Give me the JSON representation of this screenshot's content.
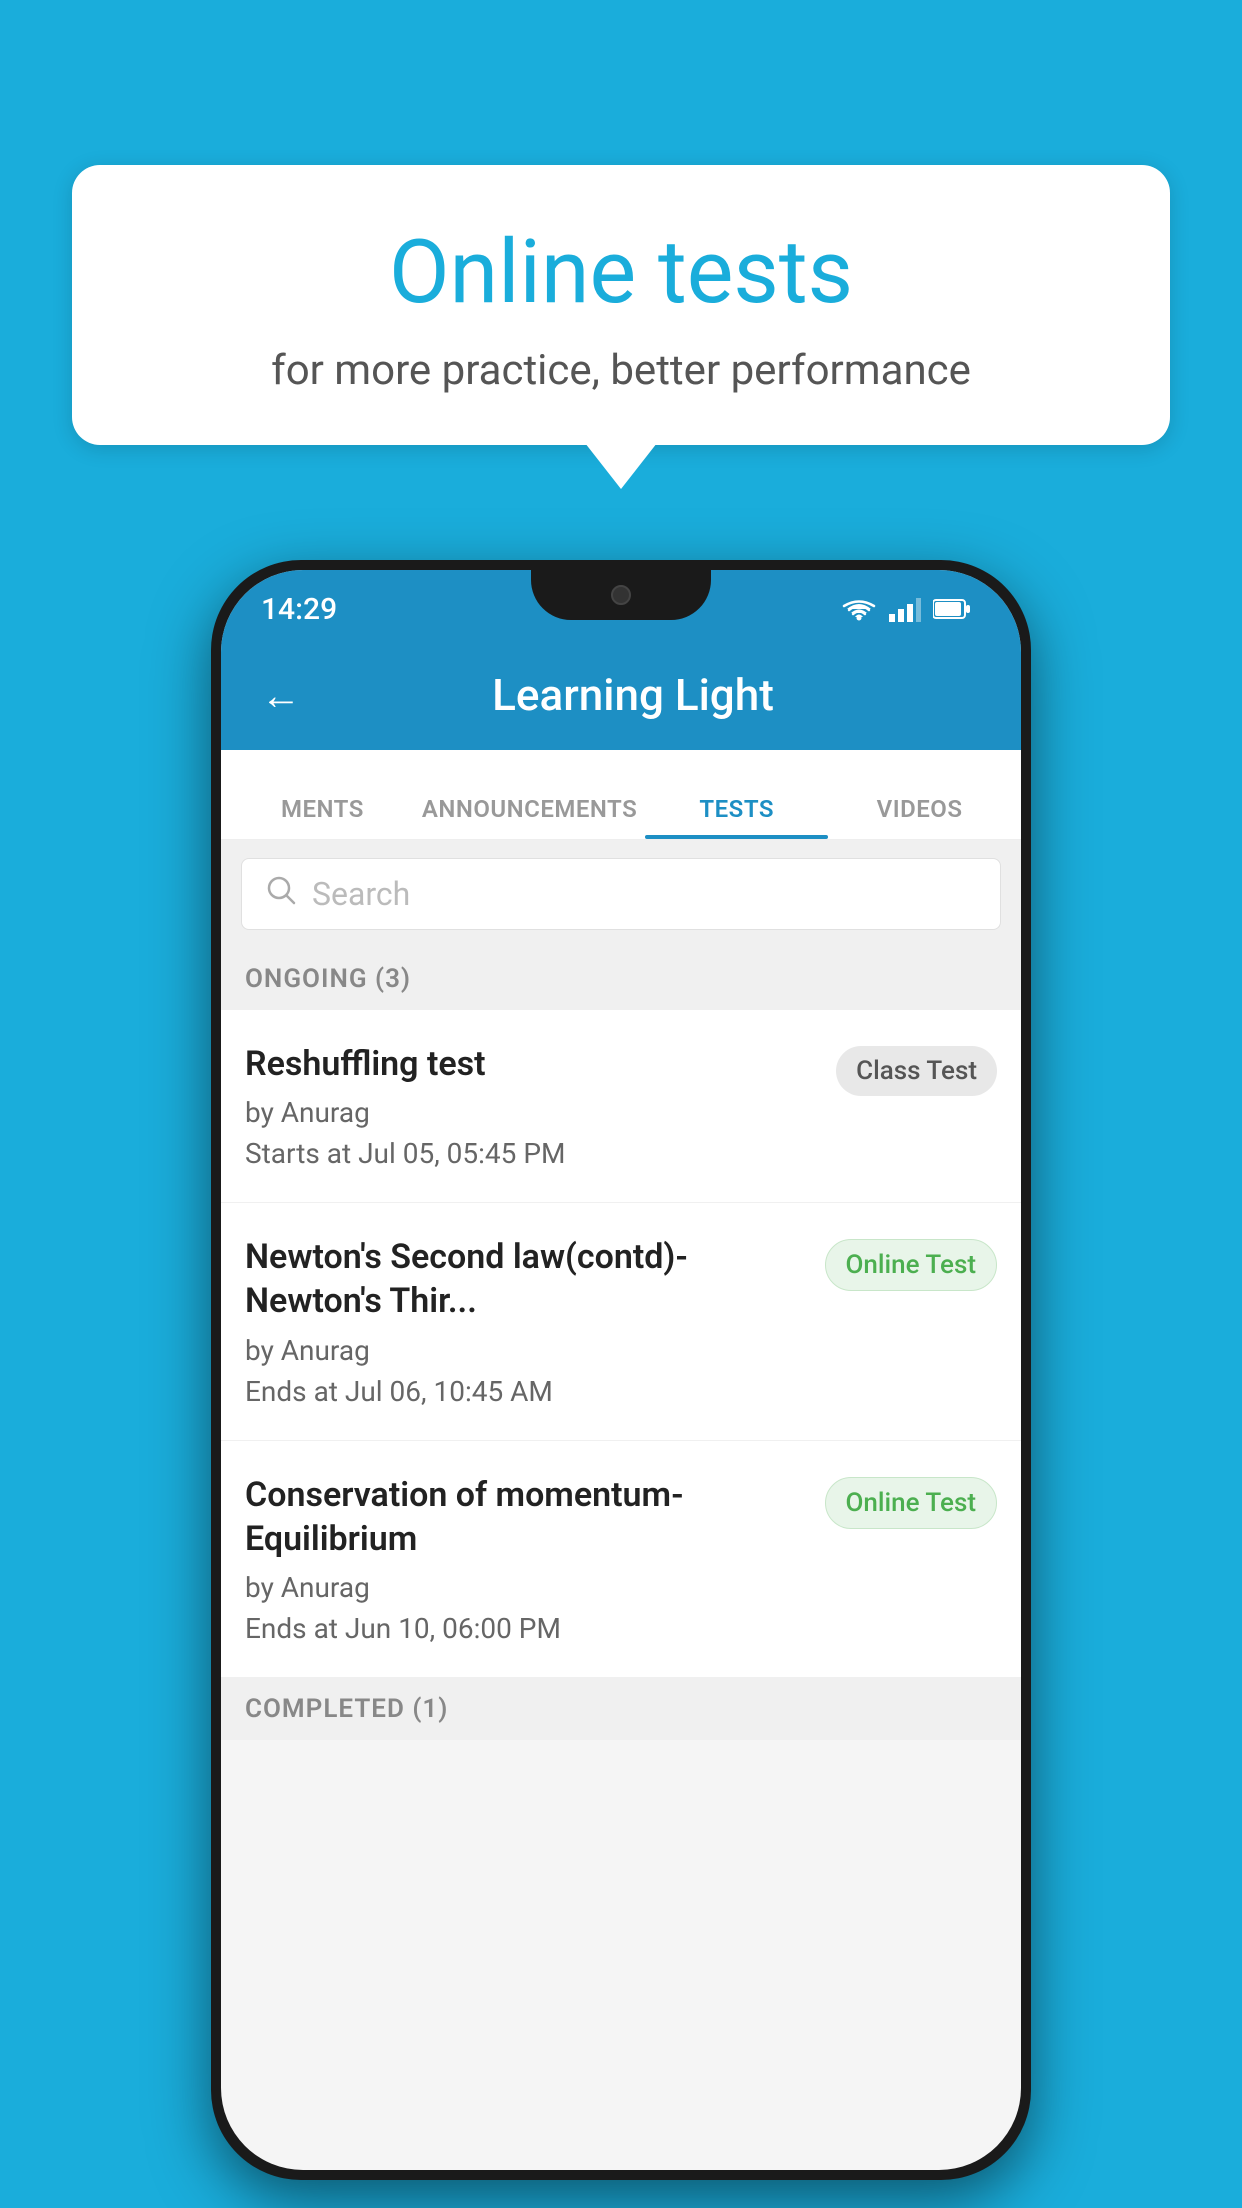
{
  "background": {
    "color": "#1AADDB"
  },
  "bubble": {
    "title": "Online tests",
    "subtitle": "for more practice, better performance"
  },
  "phone": {
    "status": {
      "time": "14:29"
    },
    "header": {
      "title": "Learning Light",
      "back_label": "←"
    },
    "tabs": [
      {
        "label": "MENTS",
        "active": false
      },
      {
        "label": "ANNOUNCEMENTS",
        "active": false
      },
      {
        "label": "TESTS",
        "active": true
      },
      {
        "label": "VIDEOS",
        "active": false
      }
    ],
    "search": {
      "placeholder": "Search"
    },
    "ongoing_section": {
      "label": "ONGOING (3)"
    },
    "tests": [
      {
        "title": "Reshuffling test",
        "author": "by Anurag",
        "date": "Starts at  Jul 05, 05:45 PM",
        "badge": "Class Test",
        "badge_type": "class"
      },
      {
        "title": "Newton's Second law(contd)-Newton's Thir...",
        "author": "by Anurag",
        "date": "Ends at  Jul 06, 10:45 AM",
        "badge": "Online Test",
        "badge_type": "online"
      },
      {
        "title": "Conservation of momentum-Equilibrium",
        "author": "by Anurag",
        "date": "Ends at  Jun 10, 06:00 PM",
        "badge": "Online Test",
        "badge_type": "online"
      }
    ],
    "completed_section": {
      "label": "COMPLETED (1)"
    }
  }
}
